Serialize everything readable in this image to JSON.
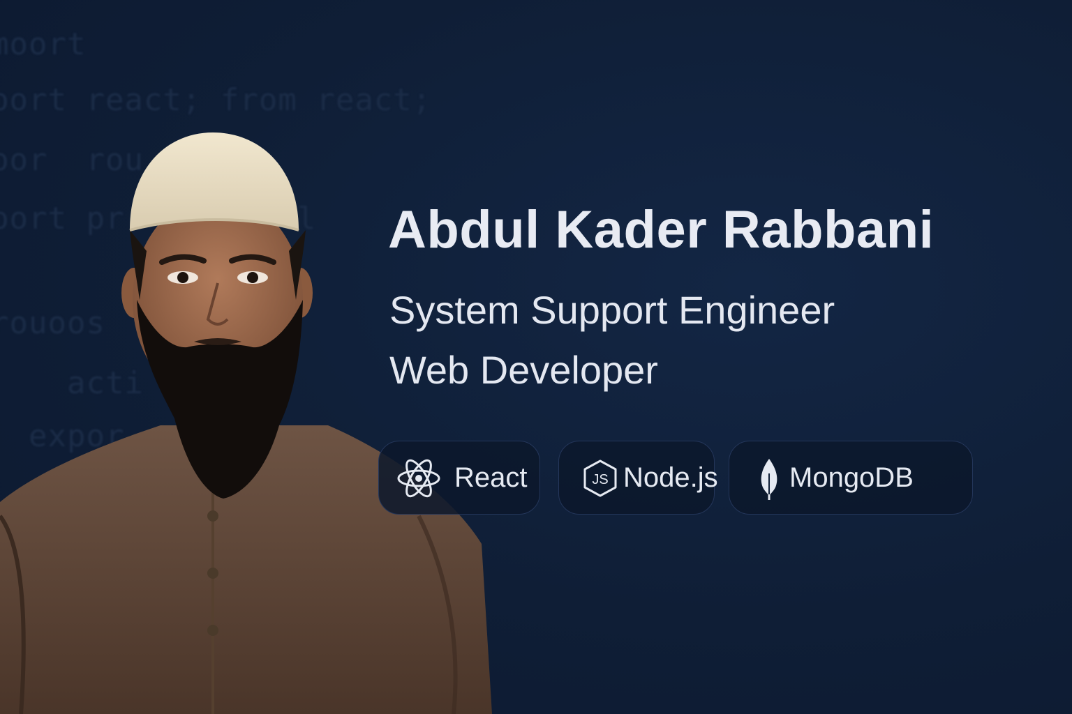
{
  "profile": {
    "name": "Abdul Kader Rabbani",
    "roles": [
      "System Support Engineer",
      "Web Developer"
    ]
  },
  "skills": [
    {
      "label": "React",
      "icon": "react-icon"
    },
    {
      "label": "Node.js",
      "icon": "nodejs-icon"
    },
    {
      "label": "MongoDB",
      "icon": "mongodb-leaf-icon"
    }
  ],
  "colors": {
    "background": "#0f1e36",
    "text": "#e8ebf3",
    "chip_border": "#24365a"
  }
}
